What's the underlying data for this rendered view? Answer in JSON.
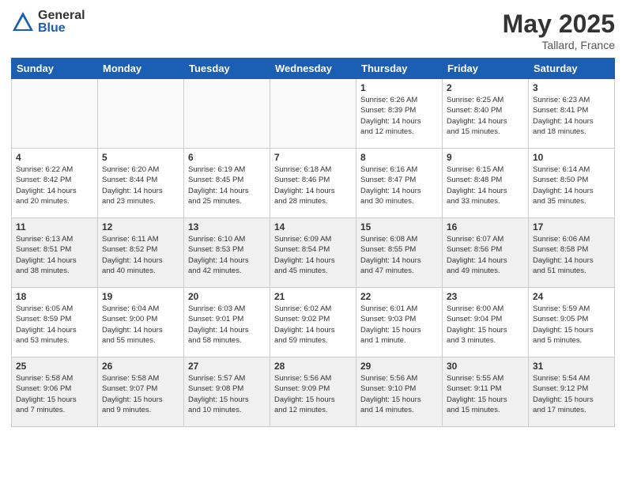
{
  "header": {
    "logo_general": "General",
    "logo_blue": "Blue",
    "month_year": "May 2025",
    "location": "Tallard, France"
  },
  "weekdays": [
    "Sunday",
    "Monday",
    "Tuesday",
    "Wednesday",
    "Thursday",
    "Friday",
    "Saturday"
  ],
  "weeks": [
    [
      {
        "day": "",
        "info": ""
      },
      {
        "day": "",
        "info": ""
      },
      {
        "day": "",
        "info": ""
      },
      {
        "day": "",
        "info": ""
      },
      {
        "day": "1",
        "info": "Sunrise: 6:26 AM\nSunset: 8:39 PM\nDaylight: 14 hours\nand 12 minutes."
      },
      {
        "day": "2",
        "info": "Sunrise: 6:25 AM\nSunset: 8:40 PM\nDaylight: 14 hours\nand 15 minutes."
      },
      {
        "day": "3",
        "info": "Sunrise: 6:23 AM\nSunset: 8:41 PM\nDaylight: 14 hours\nand 18 minutes."
      }
    ],
    [
      {
        "day": "4",
        "info": "Sunrise: 6:22 AM\nSunset: 8:42 PM\nDaylight: 14 hours\nand 20 minutes."
      },
      {
        "day": "5",
        "info": "Sunrise: 6:20 AM\nSunset: 8:44 PM\nDaylight: 14 hours\nand 23 minutes."
      },
      {
        "day": "6",
        "info": "Sunrise: 6:19 AM\nSunset: 8:45 PM\nDaylight: 14 hours\nand 25 minutes."
      },
      {
        "day": "7",
        "info": "Sunrise: 6:18 AM\nSunset: 8:46 PM\nDaylight: 14 hours\nand 28 minutes."
      },
      {
        "day": "8",
        "info": "Sunrise: 6:16 AM\nSunset: 8:47 PM\nDaylight: 14 hours\nand 30 minutes."
      },
      {
        "day": "9",
        "info": "Sunrise: 6:15 AM\nSunset: 8:48 PM\nDaylight: 14 hours\nand 33 minutes."
      },
      {
        "day": "10",
        "info": "Sunrise: 6:14 AM\nSunset: 8:50 PM\nDaylight: 14 hours\nand 35 minutes."
      }
    ],
    [
      {
        "day": "11",
        "info": "Sunrise: 6:13 AM\nSunset: 8:51 PM\nDaylight: 14 hours\nand 38 minutes."
      },
      {
        "day": "12",
        "info": "Sunrise: 6:11 AM\nSunset: 8:52 PM\nDaylight: 14 hours\nand 40 minutes."
      },
      {
        "day": "13",
        "info": "Sunrise: 6:10 AM\nSunset: 8:53 PM\nDaylight: 14 hours\nand 42 minutes."
      },
      {
        "day": "14",
        "info": "Sunrise: 6:09 AM\nSunset: 8:54 PM\nDaylight: 14 hours\nand 45 minutes."
      },
      {
        "day": "15",
        "info": "Sunrise: 6:08 AM\nSunset: 8:55 PM\nDaylight: 14 hours\nand 47 minutes."
      },
      {
        "day": "16",
        "info": "Sunrise: 6:07 AM\nSunset: 8:56 PM\nDaylight: 14 hours\nand 49 minutes."
      },
      {
        "day": "17",
        "info": "Sunrise: 6:06 AM\nSunset: 8:58 PM\nDaylight: 14 hours\nand 51 minutes."
      }
    ],
    [
      {
        "day": "18",
        "info": "Sunrise: 6:05 AM\nSunset: 8:59 PM\nDaylight: 14 hours\nand 53 minutes."
      },
      {
        "day": "19",
        "info": "Sunrise: 6:04 AM\nSunset: 9:00 PM\nDaylight: 14 hours\nand 55 minutes."
      },
      {
        "day": "20",
        "info": "Sunrise: 6:03 AM\nSunset: 9:01 PM\nDaylight: 14 hours\nand 58 minutes."
      },
      {
        "day": "21",
        "info": "Sunrise: 6:02 AM\nSunset: 9:02 PM\nDaylight: 14 hours\nand 59 minutes."
      },
      {
        "day": "22",
        "info": "Sunrise: 6:01 AM\nSunset: 9:03 PM\nDaylight: 15 hours\nand 1 minute."
      },
      {
        "day": "23",
        "info": "Sunrise: 6:00 AM\nSunset: 9:04 PM\nDaylight: 15 hours\nand 3 minutes."
      },
      {
        "day": "24",
        "info": "Sunrise: 5:59 AM\nSunset: 9:05 PM\nDaylight: 15 hours\nand 5 minutes."
      }
    ],
    [
      {
        "day": "25",
        "info": "Sunrise: 5:58 AM\nSunset: 9:06 PM\nDaylight: 15 hours\nand 7 minutes."
      },
      {
        "day": "26",
        "info": "Sunrise: 5:58 AM\nSunset: 9:07 PM\nDaylight: 15 hours\nand 9 minutes."
      },
      {
        "day": "27",
        "info": "Sunrise: 5:57 AM\nSunset: 9:08 PM\nDaylight: 15 hours\nand 10 minutes."
      },
      {
        "day": "28",
        "info": "Sunrise: 5:56 AM\nSunset: 9:09 PM\nDaylight: 15 hours\nand 12 minutes."
      },
      {
        "day": "29",
        "info": "Sunrise: 5:56 AM\nSunset: 9:10 PM\nDaylight: 15 hours\nand 14 minutes."
      },
      {
        "day": "30",
        "info": "Sunrise: 5:55 AM\nSunset: 9:11 PM\nDaylight: 15 hours\nand 15 minutes."
      },
      {
        "day": "31",
        "info": "Sunrise: 5:54 AM\nSunset: 9:12 PM\nDaylight: 15 hours\nand 17 minutes."
      }
    ]
  ]
}
